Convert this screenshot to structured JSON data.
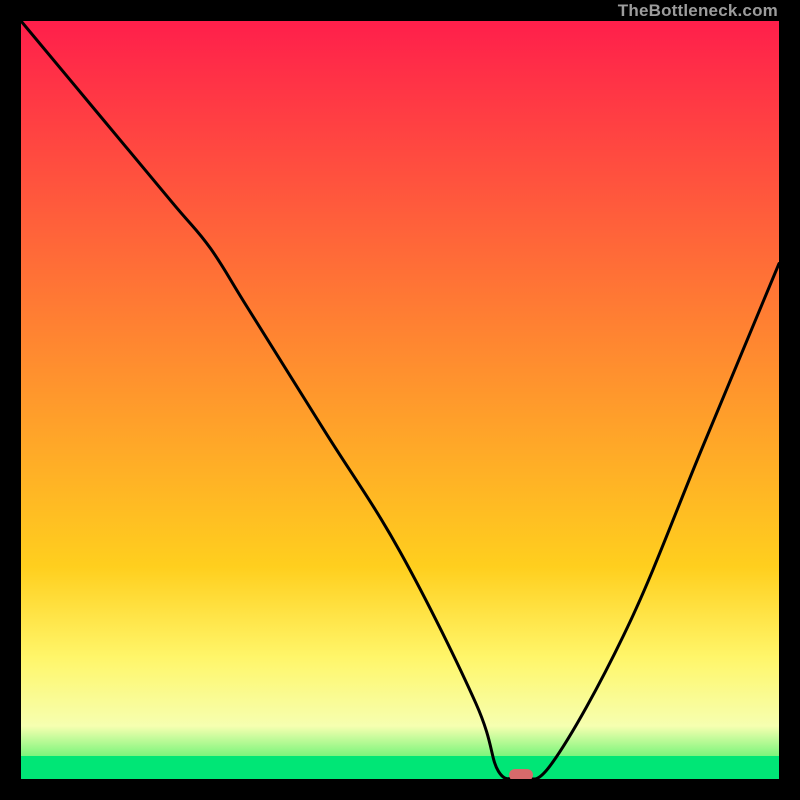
{
  "watermark": "TheBottleneck.com",
  "colors": {
    "top": "#ff1f4b",
    "mid_upper": "#ff7a2e",
    "mid": "#ffcf1e",
    "mid_lower": "#fff66a",
    "pale": "#f6ffb0",
    "green": "#00e676",
    "curve": "#000000",
    "marker": "#d76a6b",
    "frame": "#000000"
  },
  "chart_data": {
    "type": "line",
    "title": "",
    "xlabel": "",
    "ylabel": "",
    "xlim": [
      0,
      100
    ],
    "ylim": [
      0,
      100
    ],
    "x": [
      0,
      10,
      20,
      25,
      30,
      40,
      50,
      60,
      63,
      66,
      70,
      80,
      90,
      100
    ],
    "values": [
      100,
      88,
      76,
      70,
      62,
      46,
      30,
      10,
      1,
      0.5,
      2,
      20,
      44,
      68
    ],
    "minimum": {
      "x": 66,
      "y": 0.5
    },
    "gradient_bands": [
      {
        "from_pct": 0,
        "to_pct": 72,
        "color_from": "#ff1f4b",
        "color_to": "#ffcf1e"
      },
      {
        "from_pct": 72,
        "to_pct": 84,
        "color_from": "#ffcf1e",
        "color_to": "#fff66a"
      },
      {
        "from_pct": 84,
        "to_pct": 93,
        "color_from": "#fff66a",
        "color_to": "#f6ffb0"
      },
      {
        "from_pct": 93,
        "to_pct": 97,
        "color_from": "#f6ffb0",
        "color_to": "#7cf57c"
      },
      {
        "from_pct": 97,
        "to_pct": 100,
        "color_flat": "#00e676"
      }
    ]
  }
}
